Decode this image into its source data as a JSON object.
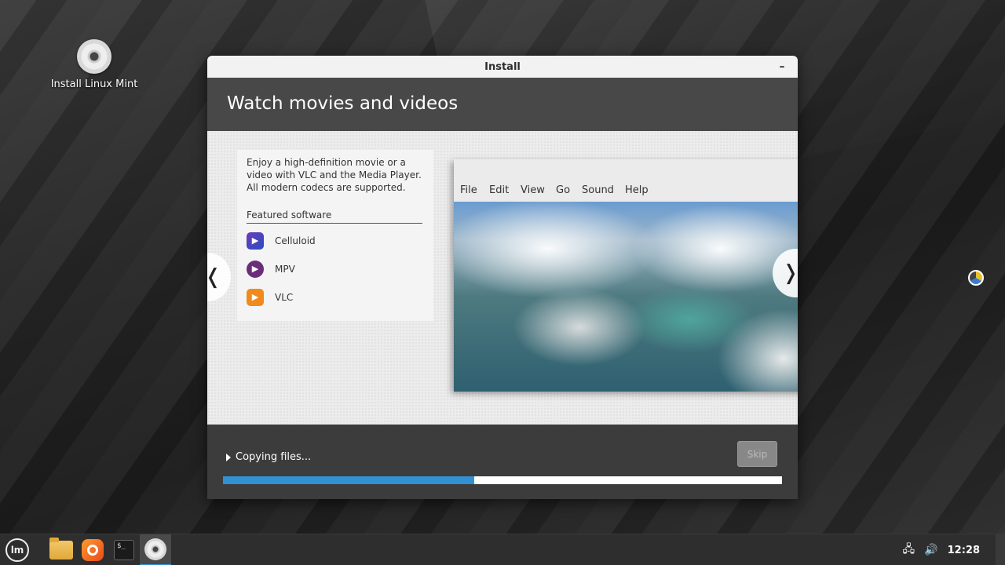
{
  "desktop": {
    "icon_label": "Install Linux Mint"
  },
  "window": {
    "title": "Install",
    "minimize_label": "–"
  },
  "slide": {
    "heading": "Watch movies and videos",
    "description": "Enjoy a high-definition movie or a video with VLC and the Media Player. All modern codecs are supported.",
    "featured_heading": "Featured software",
    "software": [
      {
        "name": "Celluloid",
        "icon": "celluloid-icon"
      },
      {
        "name": "MPV",
        "icon": "mpv-icon"
      },
      {
        "name": "VLC",
        "icon": "vlc-icon"
      }
    ],
    "screenshot_menu": [
      "File",
      "Edit",
      "View",
      "Go",
      "Sound",
      "Help"
    ],
    "prev_arrow": "❬",
    "next_arrow": "❭"
  },
  "footer": {
    "status": "Copying files...",
    "skip_label": "Skip",
    "progress_fraction": 0.45,
    "progress_color": "#3291d3"
  },
  "taskbar": {
    "menu_label": "lm",
    "terminal_label": "$_",
    "clock": "12:28",
    "network_icon": "network-icon",
    "volume_icon": "volume-icon"
  }
}
